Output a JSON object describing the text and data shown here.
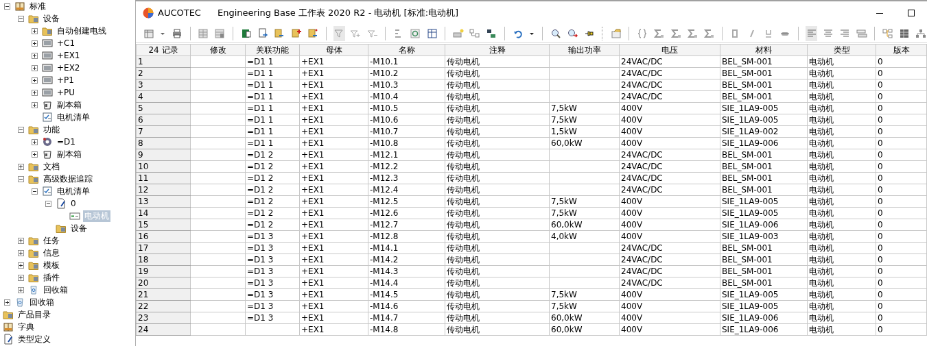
{
  "tree": {
    "nodes": [
      {
        "label": "标准",
        "kind": "book",
        "expanded": true,
        "selected": false,
        "children": [
          {
            "label": "设备",
            "kind": "folder",
            "expanded": true,
            "selected": false,
            "children": [
              {
                "label": "自动创建电线",
                "kind": "folder",
                "expanded": false,
                "selected": false
              },
              {
                "label": "+C1",
                "kind": "module",
                "expanded": false,
                "selected": false
              },
              {
                "label": "+EX1",
                "kind": "module",
                "expanded": false,
                "selected": false
              },
              {
                "label": "+EX2",
                "kind": "module",
                "expanded": false,
                "selected": false
              },
              {
                "label": "+P1",
                "kind": "module",
                "expanded": false,
                "selected": false
              },
              {
                "label": "+PU",
                "kind": "module",
                "expanded": false,
                "selected": false
              },
              {
                "label": "副本箱",
                "kind": "bin",
                "expanded": false,
                "selected": false
              },
              {
                "label": "电机清单",
                "kind": "list",
                "selected": false
              }
            ]
          },
          {
            "label": "功能",
            "kind": "folder",
            "expanded": true,
            "selected": false,
            "children": [
              {
                "label": "=D1",
                "kind": "gear",
                "expanded": false,
                "selected": false
              },
              {
                "label": "副本箱",
                "kind": "bin",
                "expanded": false,
                "selected": false
              }
            ]
          },
          {
            "label": "文档",
            "kind": "folder",
            "expanded": false,
            "selected": false
          },
          {
            "label": "高级数据追踪",
            "kind": "folder",
            "expanded": true,
            "selected": false,
            "children": [
              {
                "label": "电机清单",
                "kind": "list",
                "expanded": true,
                "selected": false,
                "children": [
                  {
                    "label": "0",
                    "kind": "document",
                    "expanded": true,
                    "selected": false,
                    "children": [
                      {
                        "label": "电动机",
                        "kind": "record",
                        "selected": true
                      }
                    ]
                  },
                  {
                    "label": "设备",
                    "kind": "folder",
                    "selected": false
                  }
                ]
              }
            ]
          },
          {
            "label": "任务",
            "kind": "folder",
            "expanded": false,
            "selected": false
          },
          {
            "label": "信息",
            "kind": "folder",
            "expanded": false,
            "selected": false
          },
          {
            "label": "模板",
            "kind": "folder",
            "expanded": false,
            "selected": false
          },
          {
            "label": "插件",
            "kind": "folder",
            "expanded": false,
            "selected": false
          },
          {
            "label": "回收箱",
            "kind": "recycle",
            "expanded": false,
            "selected": false
          }
        ]
      },
      {
        "label": "回收箱",
        "kind": "recycle",
        "expanded": false,
        "selected": false
      }
    ],
    "fixed_items": [
      {
        "label": "产品目录",
        "kind": "folder"
      },
      {
        "label": "字典",
        "kind": "book"
      },
      {
        "label": "类型定义",
        "kind": "document"
      }
    ]
  },
  "window": {
    "logo_text": "AUCOTEC",
    "title": "Engineering Base 工作表 2020 R2  - 电动机 [标准:电动机]"
  },
  "table": {
    "columns": [
      "24 记录",
      "修改",
      "关联功能",
      "母体",
      "名称",
      "注释",
      "输出功率",
      "电压",
      "材料",
      "类型",
      "版本"
    ],
    "rows": [
      [
        "1",
        null,
        "=D1 1",
        "+EX1",
        "-M10.1",
        "传动电机",
        null,
        "24VAC/DC",
        "BEL_SM-001",
        "电动机",
        "0"
      ],
      [
        "2",
        null,
        "=D1 1",
        "+EX1",
        "-M10.2",
        "传动电机",
        null,
        "24VAC/DC",
        "BEL_SM-001",
        "电动机",
        "0"
      ],
      [
        "3",
        null,
        "=D1 1",
        "+EX1",
        "-M10.3",
        "传动电机",
        null,
        "24VAC/DC",
        "BEL_SM-001",
        "电动机",
        "0"
      ],
      [
        "4",
        null,
        "=D1 1",
        "+EX1",
        "-M10.4",
        "传动电机",
        null,
        "24VAC/DC",
        "BEL_SM-001",
        "电动机",
        "0"
      ],
      [
        "5",
        null,
        "=D1 1",
        "+EX1",
        "-M10.5",
        "传动电机",
        "7,5kW",
        "400V",
        "SIE_1LA9-005",
        "电动机",
        "0"
      ],
      [
        "6",
        null,
        "=D1 1",
        "+EX1",
        "-M10.6",
        "传动电机",
        "7,5kW",
        "400V",
        "SIE_1LA9-005",
        "电动机",
        "0"
      ],
      [
        "7",
        null,
        "=D1 1",
        "+EX1",
        "-M10.7",
        "传动电机",
        "1,5kW",
        "400V",
        "SIE_1LA9-002",
        "电动机",
        "0"
      ],
      [
        "8",
        null,
        "=D1 1",
        "+EX1",
        "-M10.8",
        "传动电机",
        "60,0kW",
        "400V",
        "SIE_1LA9-006",
        "电动机",
        "0"
      ],
      [
        "9",
        null,
        "=D1 2",
        "+EX1",
        "-M12.1",
        "传动电机",
        null,
        "24VAC/DC",
        "BEL_SM-001",
        "电动机",
        "0"
      ],
      [
        "10",
        null,
        "=D1 2",
        "+EX1",
        "-M12.2",
        "传动电机",
        null,
        "24VAC/DC",
        "BEL_SM-001",
        "电动机",
        "0"
      ],
      [
        "11",
        null,
        "=D1 2",
        "+EX1",
        "-M12.3",
        "传动电机",
        null,
        "24VAC/DC",
        "BEL_SM-001",
        "电动机",
        "0"
      ],
      [
        "12",
        null,
        "=D1 2",
        "+EX1",
        "-M12.4",
        "传动电机",
        null,
        "24VAC/DC",
        "BEL_SM-001",
        "电动机",
        "0"
      ],
      [
        "13",
        null,
        "=D1 2",
        "+EX1",
        "-M12.5",
        "传动电机",
        "7,5kW",
        "400V",
        "SIE_1LA9-005",
        "电动机",
        "0"
      ],
      [
        "14",
        null,
        "=D1 2",
        "+EX1",
        "-M12.6",
        "传动电机",
        "7,5kW",
        "400V",
        "SIE_1LA9-005",
        "电动机",
        "0"
      ],
      [
        "15",
        null,
        "=D1 2",
        "+EX1",
        "-M12.7",
        "传动电机",
        "60,0kW",
        "400V",
        "SIE_1LA9-006",
        "电动机",
        "0"
      ],
      [
        "16",
        null,
        "=D1 3",
        "+EX1",
        "-M12.8",
        "传动电机",
        "4,0kW",
        "400V",
        "SIE_1LA9-003",
        "电动机",
        "0"
      ],
      [
        "17",
        null,
        "=D1 3",
        "+EX1",
        "-M14.1",
        "传动电机",
        null,
        "24VAC/DC",
        "BEL_SM-001",
        "电动机",
        "0"
      ],
      [
        "18",
        null,
        "=D1 3",
        "+EX1",
        "-M14.2",
        "传动电机",
        null,
        "24VAC/DC",
        "BEL_SM-001",
        "电动机",
        "0"
      ],
      [
        "19",
        null,
        "=D1 3",
        "+EX1",
        "-M14.3",
        "传动电机",
        null,
        "24VAC/DC",
        "BEL_SM-001",
        "电动机",
        "0"
      ],
      [
        "20",
        null,
        "=D1 3",
        "+EX1",
        "-M14.4",
        "传动电机",
        null,
        "24VAC/DC",
        "BEL_SM-001",
        "电动机",
        "0"
      ],
      [
        "21",
        null,
        "=D1 3",
        "+EX1",
        "-M14.5",
        "传动电机",
        "7,5kW",
        "400V",
        "SIE_1LA9-005",
        "电动机",
        "0"
      ],
      [
        "22",
        null,
        "=D1 3",
        "+EX1",
        "-M14.6",
        "传动电机",
        "7,5kW",
        "400V",
        "SIE_1LA9-005",
        "电动机",
        "0"
      ],
      [
        "23",
        null,
        "=D1 3",
        "+EX1",
        "-M14.7",
        "传动电机",
        "60,0kW",
        "400V",
        "SIE_1LA9-006",
        "电动机",
        "0"
      ],
      [
        "24",
        null,
        null,
        "+EX1",
        "-M14.8",
        "传动电机",
        "60,0kW",
        "400V",
        "SIE_1LA9-006",
        "电动机",
        "0"
      ]
    ]
  }
}
